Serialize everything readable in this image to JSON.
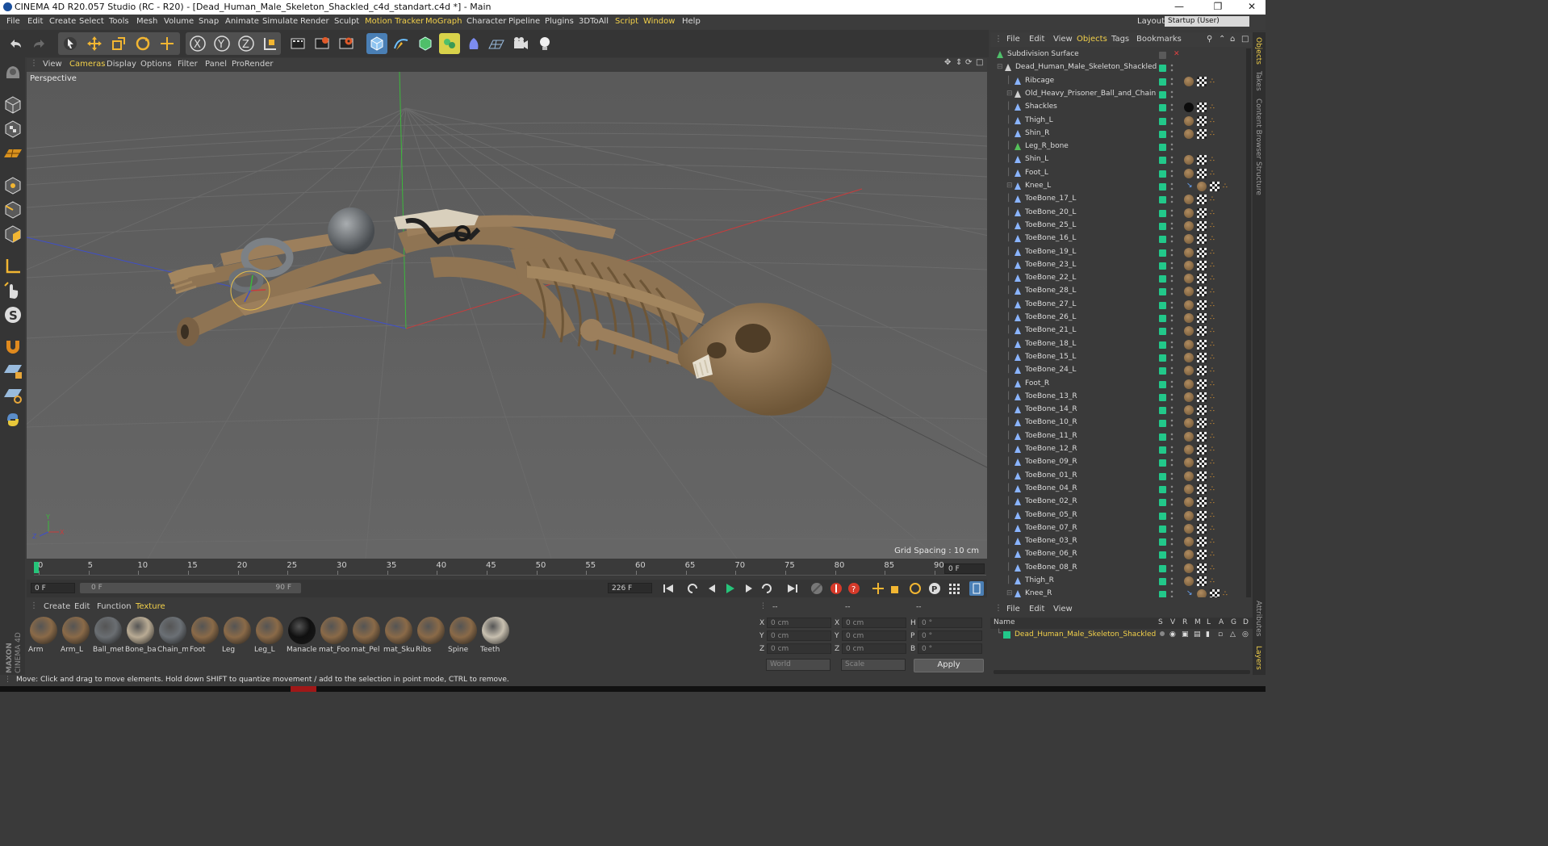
{
  "window": {
    "title": "CINEMA 4D R20.057 Studio (RC - R20) - [Dead_Human_Male_Skeleton_Shackled_c4d_standart.c4d *] - Main",
    "controls": [
      "minimize-icon",
      "restore-icon",
      "close-icon"
    ]
  },
  "menubar": {
    "items": [
      "File",
      "Edit",
      "Create",
      "Select",
      "Tools",
      "Mesh",
      "Volume",
      "Snap",
      "Animate",
      "Simulate",
      "Render",
      "Sculpt",
      "Motion Tracker",
      "MoGraph",
      "Character",
      "Pipeline",
      "Plugins",
      "3DToAll",
      "Script",
      "Window",
      "Help"
    ],
    "layout_label": "Layout:",
    "layout_value": "Startup (User)"
  },
  "toolbar": {
    "icons": [
      "undo-icon",
      "redo-icon",
      "select-cursor-icon",
      "move-icon",
      "scale-icon",
      "rotate-icon",
      "move-plus-icon",
      "axis-x-icon",
      "axis-y-icon",
      "axis-z-icon",
      "coordinate-system-icon",
      "render-view-icon",
      "render-picture-viewer-icon",
      "render-settings-icon",
      "cube-primitive-icon",
      "pen-spline-icon",
      "subdivision-generator-icon",
      "array-generator-icon",
      "deformer-icon",
      "floor-environment-icon",
      "camera-icon",
      "light-icon"
    ]
  },
  "lefttools": {
    "icons": [
      "make-editable-icon",
      "model-mode-icon",
      "texture-mode-icon",
      "workplane-icon",
      "points-mode-icon",
      "edges-mode-icon",
      "polygons-mode-icon",
      "axis-mode-icon",
      "tweak-mode-icon",
      "snap-icon",
      "magnet-icon",
      "grid-lock-icon",
      "solo-icon",
      "python-icon"
    ]
  },
  "viewport": {
    "menu": [
      "View",
      "Cameras",
      "Display",
      "Options",
      "Filter",
      "Panel",
      "ProRender"
    ],
    "active_menu": "Cameras",
    "camera_label": "Perspective",
    "grid_spacing": "Grid Spacing : 10 cm"
  },
  "timeline": {
    "ticks": [
      "0",
      "5",
      "10",
      "15",
      "20",
      "25",
      "30",
      "35",
      "40",
      "45",
      "50",
      "55",
      "60",
      "65",
      "70",
      "75",
      "80",
      "85",
      "90"
    ],
    "current_frame_field": "0 F",
    "start_field": "0 F",
    "range_start": "0 F",
    "range_end": "90 F",
    "end_field": "226 F"
  },
  "material_manager": {
    "menu": [
      "Create",
      "Edit",
      "Function",
      "Texture"
    ],
    "materials": [
      {
        "name": "Arm",
        "color": "#8a6a48"
      },
      {
        "name": "Arm_L",
        "color": "#8a6a48"
      },
      {
        "name": "Ball_met",
        "color": "#6a6e72"
      },
      {
        "name": "Bone_ba",
        "color": "#b9ab94"
      },
      {
        "name": "Chain_m",
        "color": "#6b7075"
      },
      {
        "name": "Foot",
        "color": "#8a6a48"
      },
      {
        "name": "Leg",
        "color": "#8a6a48"
      },
      {
        "name": "Leg_L",
        "color": "#8a6a48"
      },
      {
        "name": "Manacle",
        "color": "#101010"
      },
      {
        "name": "mat_Foo",
        "color": "#8a6a48"
      },
      {
        "name": "mat_Pel",
        "color": "#8a6a48"
      },
      {
        "name": "mat_Sku",
        "color": "#8a6a48"
      },
      {
        "name": "Ribs",
        "color": "#8a6a48"
      },
      {
        "name": "Spine",
        "color": "#8a6a48"
      },
      {
        "name": "Teeth",
        "color": "#c8c0b0"
      }
    ]
  },
  "coordinates": {
    "header": [
      "--",
      "--",
      "--"
    ],
    "rows": [
      {
        "l1": "X",
        "v1": "0 cm",
        "l2": "X",
        "v2": "0 cm",
        "l3": "H",
        "v3": "0 °"
      },
      {
        "l1": "Y",
        "v1": "0 cm",
        "l2": "Y",
        "v2": "0 cm",
        "l3": "P",
        "v3": "0 °"
      },
      {
        "l1": "Z",
        "v1": "0 cm",
        "l2": "Z",
        "v2": "0 cm",
        "l3": "B",
        "v3": "0 °"
      }
    ],
    "world_select": "World",
    "scale_select": "Scale",
    "apply_label": "Apply"
  },
  "object_manager": {
    "menu": [
      "File",
      "Edit",
      "View",
      "Objects",
      "Tags",
      "Bookmarks"
    ],
    "active_menu": "Objects",
    "objects": [
      {
        "name": "Subdivision Surface",
        "depth": 0,
        "tags": "none"
      },
      {
        "name": "Dead_Human_Male_Skeleton_Shackled",
        "depth": 1,
        "tags": "none"
      },
      {
        "name": "Ribcage",
        "depth": 2,
        "tags": "mat"
      },
      {
        "name": "Old_Heavy_Prisoner_Ball_and_Chain",
        "depth": 2,
        "tags": "none"
      },
      {
        "name": "Shackles",
        "depth": 2,
        "tags": "dark"
      },
      {
        "name": "Thigh_L",
        "depth": 2,
        "tags": "mat"
      },
      {
        "name": "Shin_R",
        "depth": 2,
        "tags": "mat"
      },
      {
        "name": "Leg_R_bone",
        "depth": 2,
        "tags": "none"
      },
      {
        "name": "Shin_L",
        "depth": 2,
        "tags": "mat"
      },
      {
        "name": "Foot_L",
        "depth": 2,
        "tags": "mat"
      },
      {
        "name": "Knee_L",
        "depth": 2,
        "tags": "knee"
      },
      {
        "name": "ToeBone_17_L",
        "depth": 2,
        "tags": "mat"
      },
      {
        "name": "ToeBone_20_L",
        "depth": 2,
        "tags": "mat"
      },
      {
        "name": "ToeBone_25_L",
        "depth": 2,
        "tags": "mat"
      },
      {
        "name": "ToeBone_16_L",
        "depth": 2,
        "tags": "mat"
      },
      {
        "name": "ToeBone_19_L",
        "depth": 2,
        "tags": "mat"
      },
      {
        "name": "ToeBone_23_L",
        "depth": 2,
        "tags": "mat"
      },
      {
        "name": "ToeBone_22_L",
        "depth": 2,
        "tags": "mat"
      },
      {
        "name": "ToeBone_28_L",
        "depth": 2,
        "tags": "mat"
      },
      {
        "name": "ToeBone_27_L",
        "depth": 2,
        "tags": "mat"
      },
      {
        "name": "ToeBone_26_L",
        "depth": 2,
        "tags": "mat"
      },
      {
        "name": "ToeBone_21_L",
        "depth": 2,
        "tags": "mat"
      },
      {
        "name": "ToeBone_18_L",
        "depth": 2,
        "tags": "mat"
      },
      {
        "name": "ToeBone_15_L",
        "depth": 2,
        "tags": "mat"
      },
      {
        "name": "ToeBone_24_L",
        "depth": 2,
        "tags": "mat"
      },
      {
        "name": "Foot_R",
        "depth": 2,
        "tags": "mat"
      },
      {
        "name": "ToeBone_13_R",
        "depth": 2,
        "tags": "mat"
      },
      {
        "name": "ToeBone_14_R",
        "depth": 2,
        "tags": "mat"
      },
      {
        "name": "ToeBone_10_R",
        "depth": 2,
        "tags": "mat"
      },
      {
        "name": "ToeBone_11_R",
        "depth": 2,
        "tags": "mat"
      },
      {
        "name": "ToeBone_12_R",
        "depth": 2,
        "tags": "mat"
      },
      {
        "name": "ToeBone_09_R",
        "depth": 2,
        "tags": "mat"
      },
      {
        "name": "ToeBone_01_R",
        "depth": 2,
        "tags": "mat"
      },
      {
        "name": "ToeBone_04_R",
        "depth": 2,
        "tags": "mat"
      },
      {
        "name": "ToeBone_02_R",
        "depth": 2,
        "tags": "mat"
      },
      {
        "name": "ToeBone_05_R",
        "depth": 2,
        "tags": "mat"
      },
      {
        "name": "ToeBone_07_R",
        "depth": 2,
        "tags": "mat"
      },
      {
        "name": "ToeBone_03_R",
        "depth": 2,
        "tags": "mat"
      },
      {
        "name": "ToeBone_06_R",
        "depth": 2,
        "tags": "mat"
      },
      {
        "name": "ToeBone_08_R",
        "depth": 2,
        "tags": "mat"
      },
      {
        "name": "Thigh_R",
        "depth": 2,
        "tags": "mat"
      },
      {
        "name": "Knee_R",
        "depth": 2,
        "tags": "knee"
      }
    ]
  },
  "side_tabs": [
    "Objects",
    "Takes",
    "Content Browser",
    "Structure",
    "Attributes",
    "Layers"
  ],
  "attributes_manager": {
    "menu": [
      "File",
      "Edit",
      "View"
    ],
    "columns": [
      "Name",
      "S",
      "V",
      "R",
      "M",
      "L",
      "A",
      "G",
      "D"
    ],
    "object_name": "Dead_Human_Male_Skeleton_Shackled"
  },
  "status": {
    "text": "Move: Click and drag to move elements. Hold down SHIFT to quantize movement / add to the selection in point mode, CTRL to remove."
  },
  "colors": {
    "accent": "#f2d04a",
    "enabled_green": "#22c88a",
    "bone": "#8f7453",
    "viewport_bg": "#5f5f5f"
  },
  "brand": "MAXON CINEMA 4D"
}
